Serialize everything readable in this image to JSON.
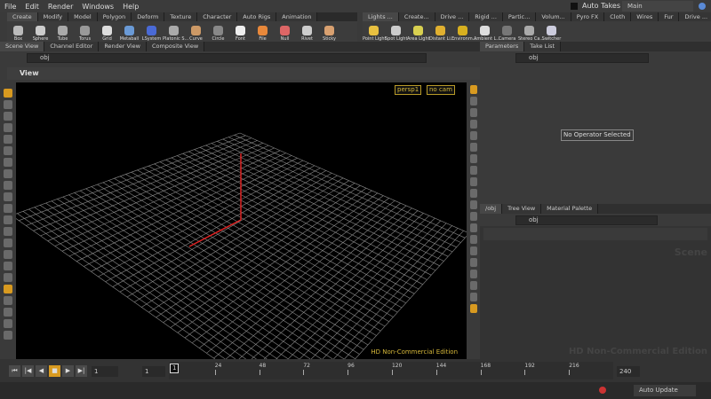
{
  "menu": [
    "File",
    "Edit",
    "Render",
    "Windows",
    "Help"
  ],
  "auto_takes": "Auto Takes",
  "desktop": "Main",
  "shelf_left": {
    "tabs": [
      "Create",
      "Modify",
      "Model",
      "Polygon",
      "Deform",
      "Texture",
      "Character",
      "Auto Rigs",
      "Animation"
    ],
    "tools": [
      "Box",
      "Sphere",
      "Tube",
      "Torus",
      "Grid",
      "Metaball",
      "LSystem",
      "Platonic S...",
      "Curve",
      "Circle",
      "Font",
      "File",
      "Null",
      "Rivet",
      "Sticky"
    ]
  },
  "shelf_right": {
    "tabs": [
      "Lights ...",
      "Create...",
      "Drive ...",
      "Rigid ...",
      "Partic...",
      "Volum...",
      "Pyro FX",
      "Cloth",
      "Wires",
      "Fur",
      "Drive ..."
    ],
    "tools": [
      "Point Light",
      "Spot Light",
      "Area Light",
      "Distant Li...",
      "Environm...",
      "Ambient L...",
      "Camera",
      "Stereo Ca...",
      "Switcher"
    ]
  },
  "left_pane_tabs": [
    "Scene View",
    "Channel Editor",
    "Render View",
    "Composite View"
  ],
  "path": "obj",
  "view_title": "View",
  "persp": "persp1",
  "cam": "no cam",
  "watermark": "HD Non-Commercial Edition",
  "params_tabs": [
    "Parameters",
    "Take List"
  ],
  "no_operator": "No Operator Selected",
  "network_tabs": [
    "/obj",
    "Tree View",
    "Material Palette"
  ],
  "network_path": "obj",
  "network_watermark": "HD Non-Commercial Edition",
  "network_scene": "Scene",
  "timeline": {
    "frame": "1",
    "start": "1",
    "current": "1",
    "end": "240",
    "ticks": [
      "24",
      "48",
      "72",
      "96",
      "120",
      "144",
      "168",
      "192",
      "216"
    ]
  },
  "auto_update": "Auto Update"
}
